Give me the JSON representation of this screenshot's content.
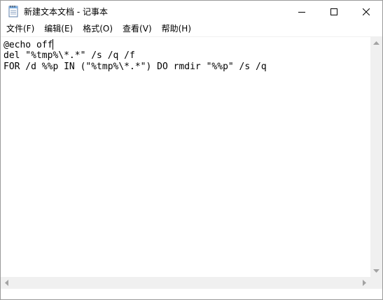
{
  "window": {
    "title": "新建文本文档 - 记事本"
  },
  "menu": {
    "items": [
      {
        "label": "文件(F)"
      },
      {
        "label": "编辑(E)"
      },
      {
        "label": "格式(O)"
      },
      {
        "label": "查看(V)"
      },
      {
        "label": "帮助(H)"
      }
    ]
  },
  "editor": {
    "lines": [
      "@echo off",
      "del \"%tmp%\\*.*\" /s /q /f",
      "FOR /d %%p IN (\"%tmp%\\*.*\") DO rmdir \"%%p\" /s /q"
    ]
  },
  "icons": {
    "app": "notepad-icon",
    "minimize": "minimize-icon",
    "maximize": "maximize-icon",
    "close": "close-icon"
  },
  "colors": {
    "background": "#ffffff",
    "scrollbar": "#f0f0f0",
    "text": "#000000"
  }
}
